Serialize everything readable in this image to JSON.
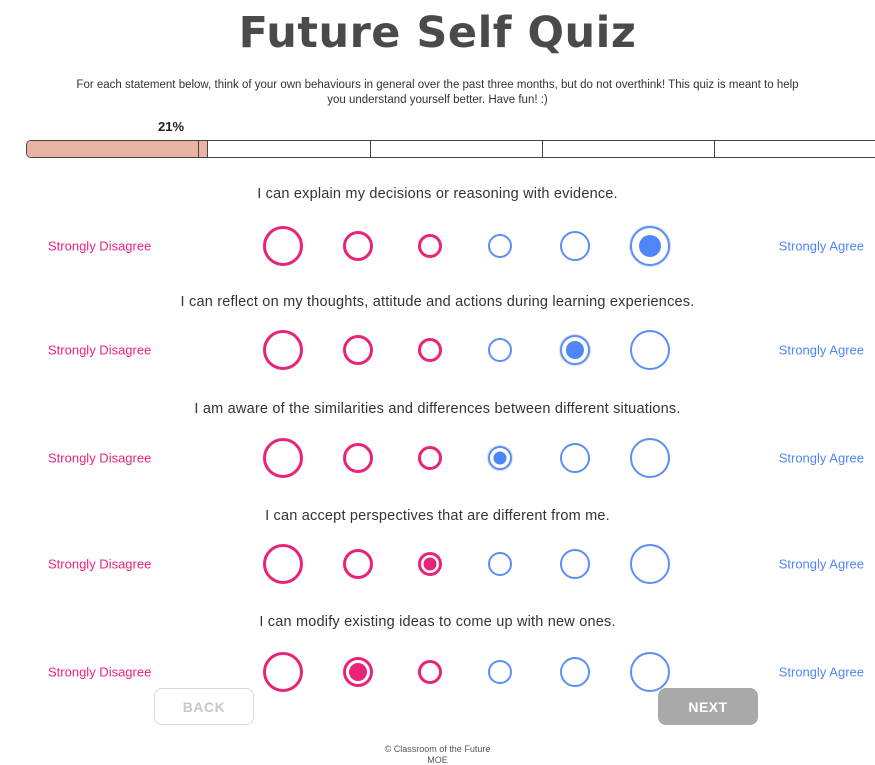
{
  "title": "Future Self Quiz",
  "intro": "For each statement below, think of your own behaviours in general over the past three months, but do not overthink! This quiz is meant to help you understand yourself better. Have fun! :)",
  "progress": {
    "label": "21%",
    "value": 0.21
  },
  "scale": {
    "left_label": "Strongly Disagree",
    "right_label": "Strongly Agree"
  },
  "questions": [
    {
      "text": "I can explain my decisions or reasoning with evidence.",
      "selected": 5
    },
    {
      "text": "I can reflect on my thoughts, attitude and actions during learning experiences.",
      "selected": 4
    },
    {
      "text": "I am aware of the similarities and differences between different situations.",
      "selected": 3
    },
    {
      "text": "I can accept perspectives that are different from me.",
      "selected": 2
    },
    {
      "text": "I can modify existing ideas to come up with new ones.",
      "selected": 1
    }
  ],
  "buttons": {
    "back": "BACK",
    "next": "NEXT"
  },
  "footer": {
    "line1": "© Classroom of the Future",
    "line2": "MOE"
  },
  "colors": {
    "disagree": "#e8247a",
    "agree": "#4f86f7",
    "progress_fill": "#e9b3a3"
  }
}
